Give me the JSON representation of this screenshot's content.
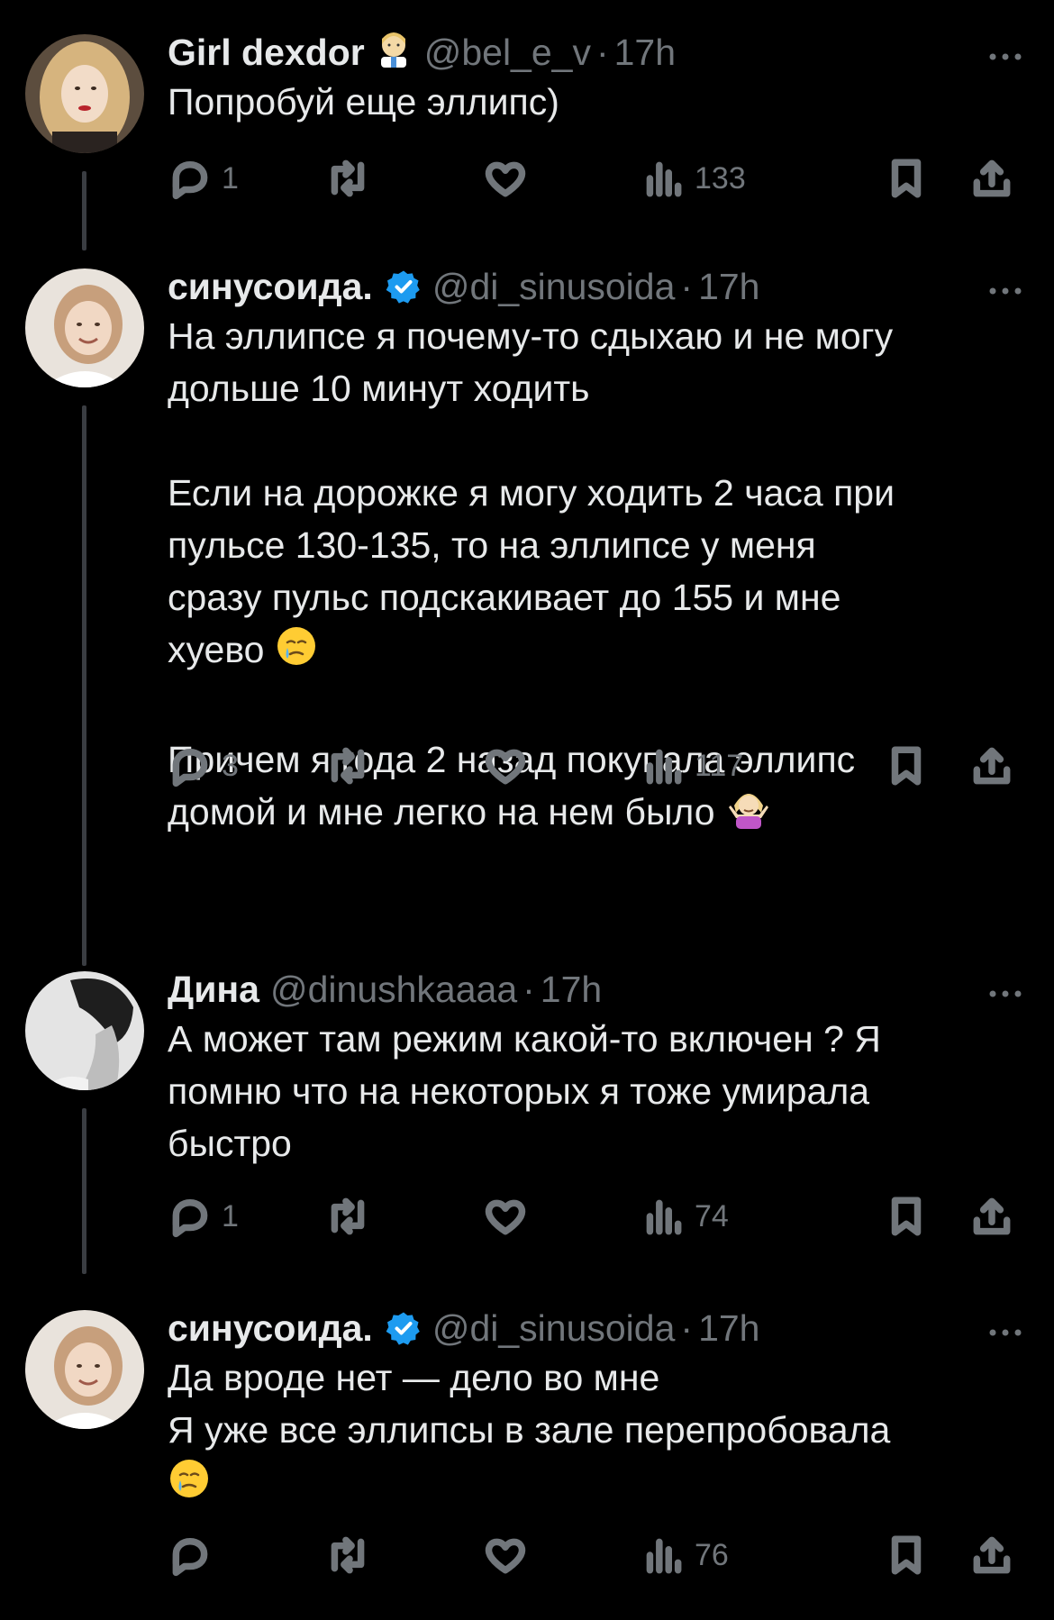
{
  "tweets": [
    {
      "name": "Girl dexdor",
      "name_emoji": "woman-health-worker-emoji",
      "verified": false,
      "handle": "@bel_e_v",
      "dot": "·",
      "time": "17h",
      "text": [
        "Попробуй еще эллипс)"
      ],
      "replies": "1",
      "views": "133",
      "avatar_colors": [
        "#6b5a48",
        "#d8b98a",
        "#2b2420"
      ]
    },
    {
      "name": "синусоида.",
      "verified": true,
      "handle": "@di_sinusoida",
      "dot": "·",
      "time": "17h",
      "text": [
        "На эллипсе я почему-то сдыхаю и не могу",
        "дольше 10 минут ходить",
        "",
        "Если на дорожке я могу ходить 2 часа при",
        "пульсе 130-135, то на эллипсе у меня",
        "сразу пульс подскакивает до 155 и мне",
        "хуево",
        "",
        "Причем я года 2 назад покупала эллипс",
        "домой и мне легко на нем было"
      ],
      "emojis": [
        "crying-face-emoji",
        "shrugging-woman-emoji"
      ],
      "replies": "3",
      "views": "117",
      "avatar_colors": [
        "#e8e1d9",
        "#c9a583",
        "#b58d6a"
      ]
    },
    {
      "name": "Дина",
      "verified": false,
      "handle": "@dinushkaaaa",
      "dot": "·",
      "time": "17h",
      "text": [
        "А может там режим какой-то включен  ? Я",
        "помню что на некоторых я тоже умирала",
        "быстро"
      ],
      "replies": "1",
      "views": "74",
      "avatar_colors": [
        "#e6e6e6",
        "#9a9a9a",
        "#2a2a2a"
      ]
    },
    {
      "name": "синусоида.",
      "verified": true,
      "handle": "@di_sinusoida",
      "dot": "·",
      "time": "17h",
      "text": [
        "Да вроде нет — дело во мне",
        "Я уже все эллипсы в зале перепробовала"
      ],
      "emojis": [
        "crying-face-emoji"
      ],
      "replies": "",
      "views": "76",
      "avatar_colors": [
        "#e8e1d9",
        "#c9a583",
        "#b58d6a"
      ]
    }
  ],
  "icons": {
    "reply": "reply-icon",
    "retweet": "retweet-icon",
    "like": "heart-icon",
    "views": "views-icon",
    "bookmark": "bookmark-icon",
    "share": "share-icon",
    "more": "more-icon",
    "verified": "verified-badge-icon"
  },
  "colors": {
    "background": "#000000",
    "text": "#e7e9ea",
    "muted": "#71767b",
    "verified": "#1d9bf0",
    "thread_line": "#3a3d42"
  }
}
